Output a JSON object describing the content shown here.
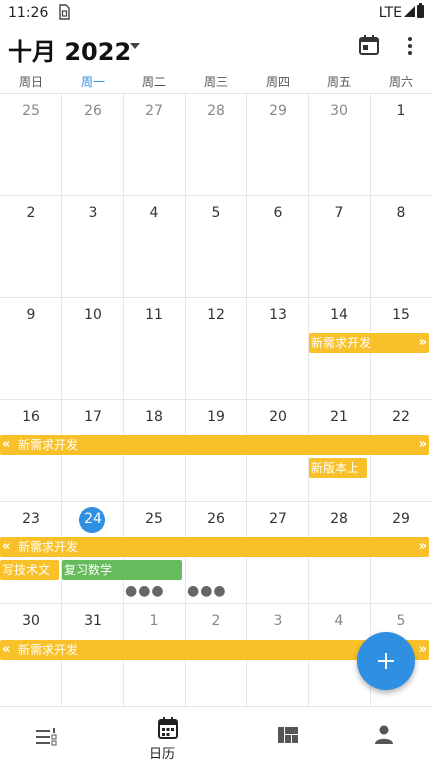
{
  "status": {
    "time": "11:26",
    "sim_glyph": "∂",
    "network": "LTE"
  },
  "header": {
    "title": "十月 2022"
  },
  "weekdays": [
    "周日",
    "周一",
    "周二",
    "周三",
    "周四",
    "周五",
    "周六"
  ],
  "today_index": 1,
  "weeks": [
    [
      "25",
      "26",
      "27",
      "28",
      "29",
      "30",
      "1"
    ],
    [
      "2",
      "3",
      "4",
      "5",
      "6",
      "7",
      "8"
    ],
    [
      "9",
      "10",
      "11",
      "12",
      "13",
      "14",
      "15"
    ],
    [
      "16",
      "17",
      "18",
      "19",
      "20",
      "21",
      "22"
    ],
    [
      "23",
      "24",
      "25",
      "26",
      "27",
      "28",
      "29"
    ],
    [
      "30",
      "31",
      "1",
      "2",
      "3",
      "4",
      "5"
    ]
  ],
  "events": {
    "new_req": "新需求开发",
    "new_version": "新版本上",
    "write_tech": "写技术文",
    "review_math": "复习数学"
  },
  "nav": {
    "calendar_label": "日历"
  },
  "colors": {
    "accent": "#2f8fe2",
    "event_yellow": "#f8c12a",
    "event_green": "#66bb5c"
  }
}
